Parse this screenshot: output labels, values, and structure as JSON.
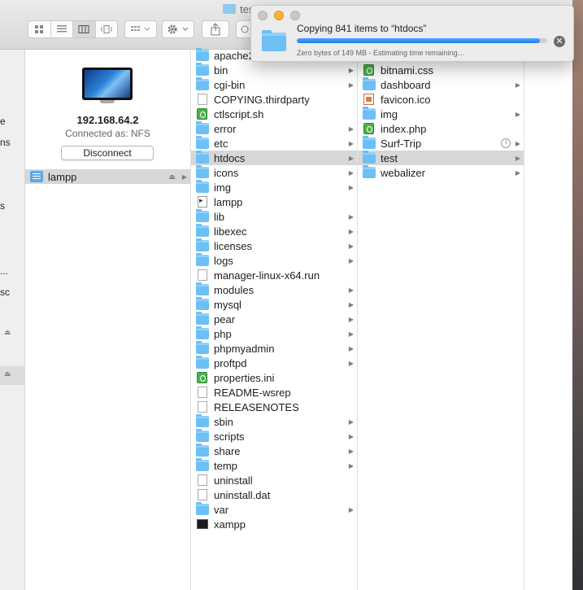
{
  "window": {
    "title": "test"
  },
  "toolbar": {
    "view_buttons": [
      "icon-view-icon",
      "list-view-icon",
      "column-view-icon",
      "cover-flow-icon"
    ],
    "arrange_icon": "grid-icon",
    "action_icon": "gear-icon",
    "share_icon": "share-icon"
  },
  "sidebar": {
    "fragments": [
      "e",
      "ns",
      "s",
      "...",
      "sc"
    ]
  },
  "server": {
    "ip": "192.168.64.2",
    "connected_as": "Connected as: NFS",
    "disconnect_label": "Disconnect",
    "volumes": [
      {
        "name": "lampp",
        "icon": "server-icon"
      }
    ]
  },
  "column2": [
    {
      "name": "apache2",
      "kind": "folder"
    },
    {
      "name": "bin",
      "kind": "folder"
    },
    {
      "name": "cgi-bin",
      "kind": "folder"
    },
    {
      "name": "COPYING.thirdparty",
      "kind": "doc"
    },
    {
      "name": "ctlscript.sh",
      "kind": "script"
    },
    {
      "name": "error",
      "kind": "folder"
    },
    {
      "name": "etc",
      "kind": "folder"
    },
    {
      "name": "htdocs",
      "kind": "folder"
    },
    {
      "name": "icons",
      "kind": "folder"
    },
    {
      "name": "img",
      "kind": "folder"
    },
    {
      "name": "lampp",
      "kind": "exec"
    },
    {
      "name": "lib",
      "kind": "folder"
    },
    {
      "name": "libexec",
      "kind": "folder"
    },
    {
      "name": "licenses",
      "kind": "folder"
    },
    {
      "name": "logs",
      "kind": "folder"
    },
    {
      "name": "manager-linux-x64.run",
      "kind": "doc"
    },
    {
      "name": "modules",
      "kind": "folder"
    },
    {
      "name": "mysql",
      "kind": "folder"
    },
    {
      "name": "pear",
      "kind": "folder"
    },
    {
      "name": "php",
      "kind": "folder"
    },
    {
      "name": "phpmyadmin",
      "kind": "folder"
    },
    {
      "name": "proftpd",
      "kind": "folder"
    },
    {
      "name": "properties.ini",
      "kind": "script"
    },
    {
      "name": "README-wsrep",
      "kind": "doc"
    },
    {
      "name": "RELEASENOTES",
      "kind": "doc"
    },
    {
      "name": "sbin",
      "kind": "folder"
    },
    {
      "name": "scripts",
      "kind": "folder"
    },
    {
      "name": "share",
      "kind": "folder"
    },
    {
      "name": "temp",
      "kind": "folder"
    },
    {
      "name": "uninstall",
      "kind": "doc"
    },
    {
      "name": "uninstall.dat",
      "kind": "doc"
    },
    {
      "name": "var",
      "kind": "folder"
    },
    {
      "name": "xampp",
      "kind": "terminal"
    }
  ],
  "column3": [
    {
      "name": "bitnami.css",
      "kind": "script"
    },
    {
      "name": "dashboard",
      "kind": "folder"
    },
    {
      "name": "favicon.ico",
      "kind": "image"
    },
    {
      "name": "img",
      "kind": "folder"
    },
    {
      "name": "index.php",
      "kind": "script"
    },
    {
      "name": "Surf-Trip",
      "kind": "folder"
    },
    {
      "name": "test",
      "kind": "folder"
    },
    {
      "name": "webalizer",
      "kind": "folder"
    }
  ],
  "copy_dialog": {
    "title": "Copying 841 items to “htdocs”",
    "status": "Zero bytes of 149 MB - Estimating time remaining…",
    "progress": 0.97
  }
}
